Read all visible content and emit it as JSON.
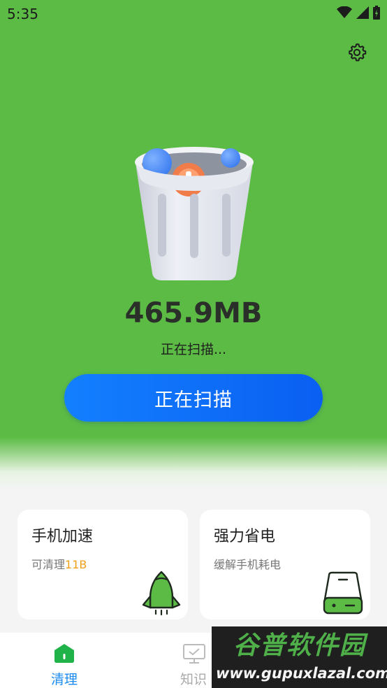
{
  "status_bar": {
    "time": "5:35"
  },
  "scan": {
    "size": "465.9MB",
    "status": "正在扫描...",
    "button_label": "正在扫描"
  },
  "cards": [
    {
      "title": "手机加速",
      "subtitle_prefix": "可清理",
      "subtitle_highlight": "11B",
      "icon": "rocket-icon"
    },
    {
      "title": "强力省电",
      "subtitle": "缓解手机耗电",
      "icon": "battery-icon"
    }
  ],
  "tabs": [
    {
      "label": "清理",
      "icon": "home-icon",
      "active": true
    },
    {
      "label": "知识",
      "icon": "board-icon",
      "active": false
    }
  ],
  "watermark": {
    "line1": "谷普软件园",
    "line2": "www.gupuxlazal.com"
  },
  "colors": {
    "hero_green": "#5bbb45",
    "button_blue": "#0f74fb",
    "accent_orange": "#f0a018",
    "tab_active": "#1b8bf0"
  }
}
